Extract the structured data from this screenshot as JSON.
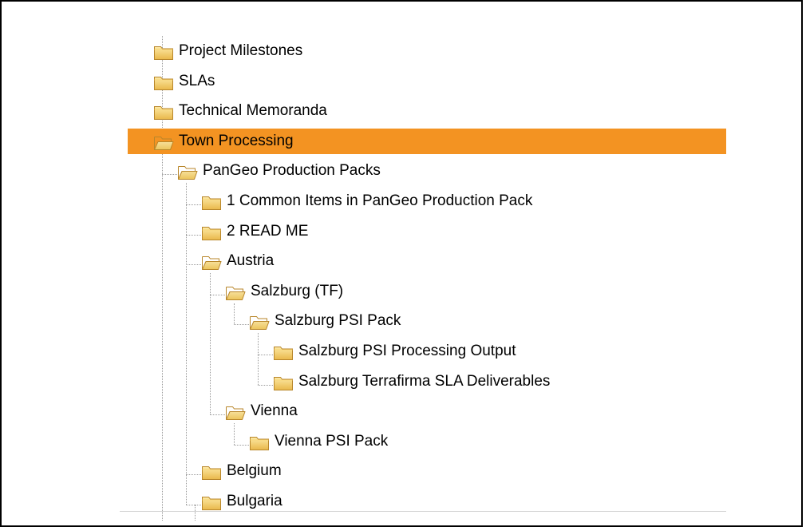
{
  "tree": {
    "selection_color": "#f39322",
    "items": [
      {
        "label": "Project Milestones",
        "level": 0,
        "state": "closed",
        "selected": false
      },
      {
        "label": "SLAs",
        "level": 0,
        "state": "closed",
        "selected": false
      },
      {
        "label": "Technical Memoranda",
        "level": 0,
        "state": "closed",
        "selected": false
      },
      {
        "label": "Town Processing",
        "level": 0,
        "state": "open",
        "selected": true
      },
      {
        "label": "PanGeo Production Packs",
        "level": 1,
        "state": "open",
        "selected": false
      },
      {
        "label": "1 Common Items in PanGeo Production Pack",
        "level": 2,
        "state": "closed",
        "selected": false
      },
      {
        "label": "2 READ ME",
        "level": 2,
        "state": "closed",
        "selected": false
      },
      {
        "label": "Austria",
        "level": 2,
        "state": "open",
        "selected": false
      },
      {
        "label": "Salzburg (TF)",
        "level": 3,
        "state": "open",
        "selected": false
      },
      {
        "label": "Salzburg PSI Pack",
        "level": 4,
        "state": "open",
        "selected": false
      },
      {
        "label": "Salzburg PSI Processing Output",
        "level": 5,
        "state": "closed",
        "selected": false
      },
      {
        "label": "Salzburg Terrafirma SLA Deliverables",
        "level": 5,
        "state": "closed",
        "selected": false
      },
      {
        "label": "Vienna",
        "level": 3,
        "state": "open",
        "selected": false
      },
      {
        "label": "Vienna PSI Pack",
        "level": 4,
        "state": "closed",
        "selected": false
      },
      {
        "label": "Belgium",
        "level": 2,
        "state": "closed",
        "selected": false
      },
      {
        "label": "Bulgaria",
        "level": 2,
        "state": "closed",
        "selected": false
      }
    ],
    "icons": {
      "closed": "folder-closed-icon",
      "open": "folder-open-icon"
    }
  }
}
